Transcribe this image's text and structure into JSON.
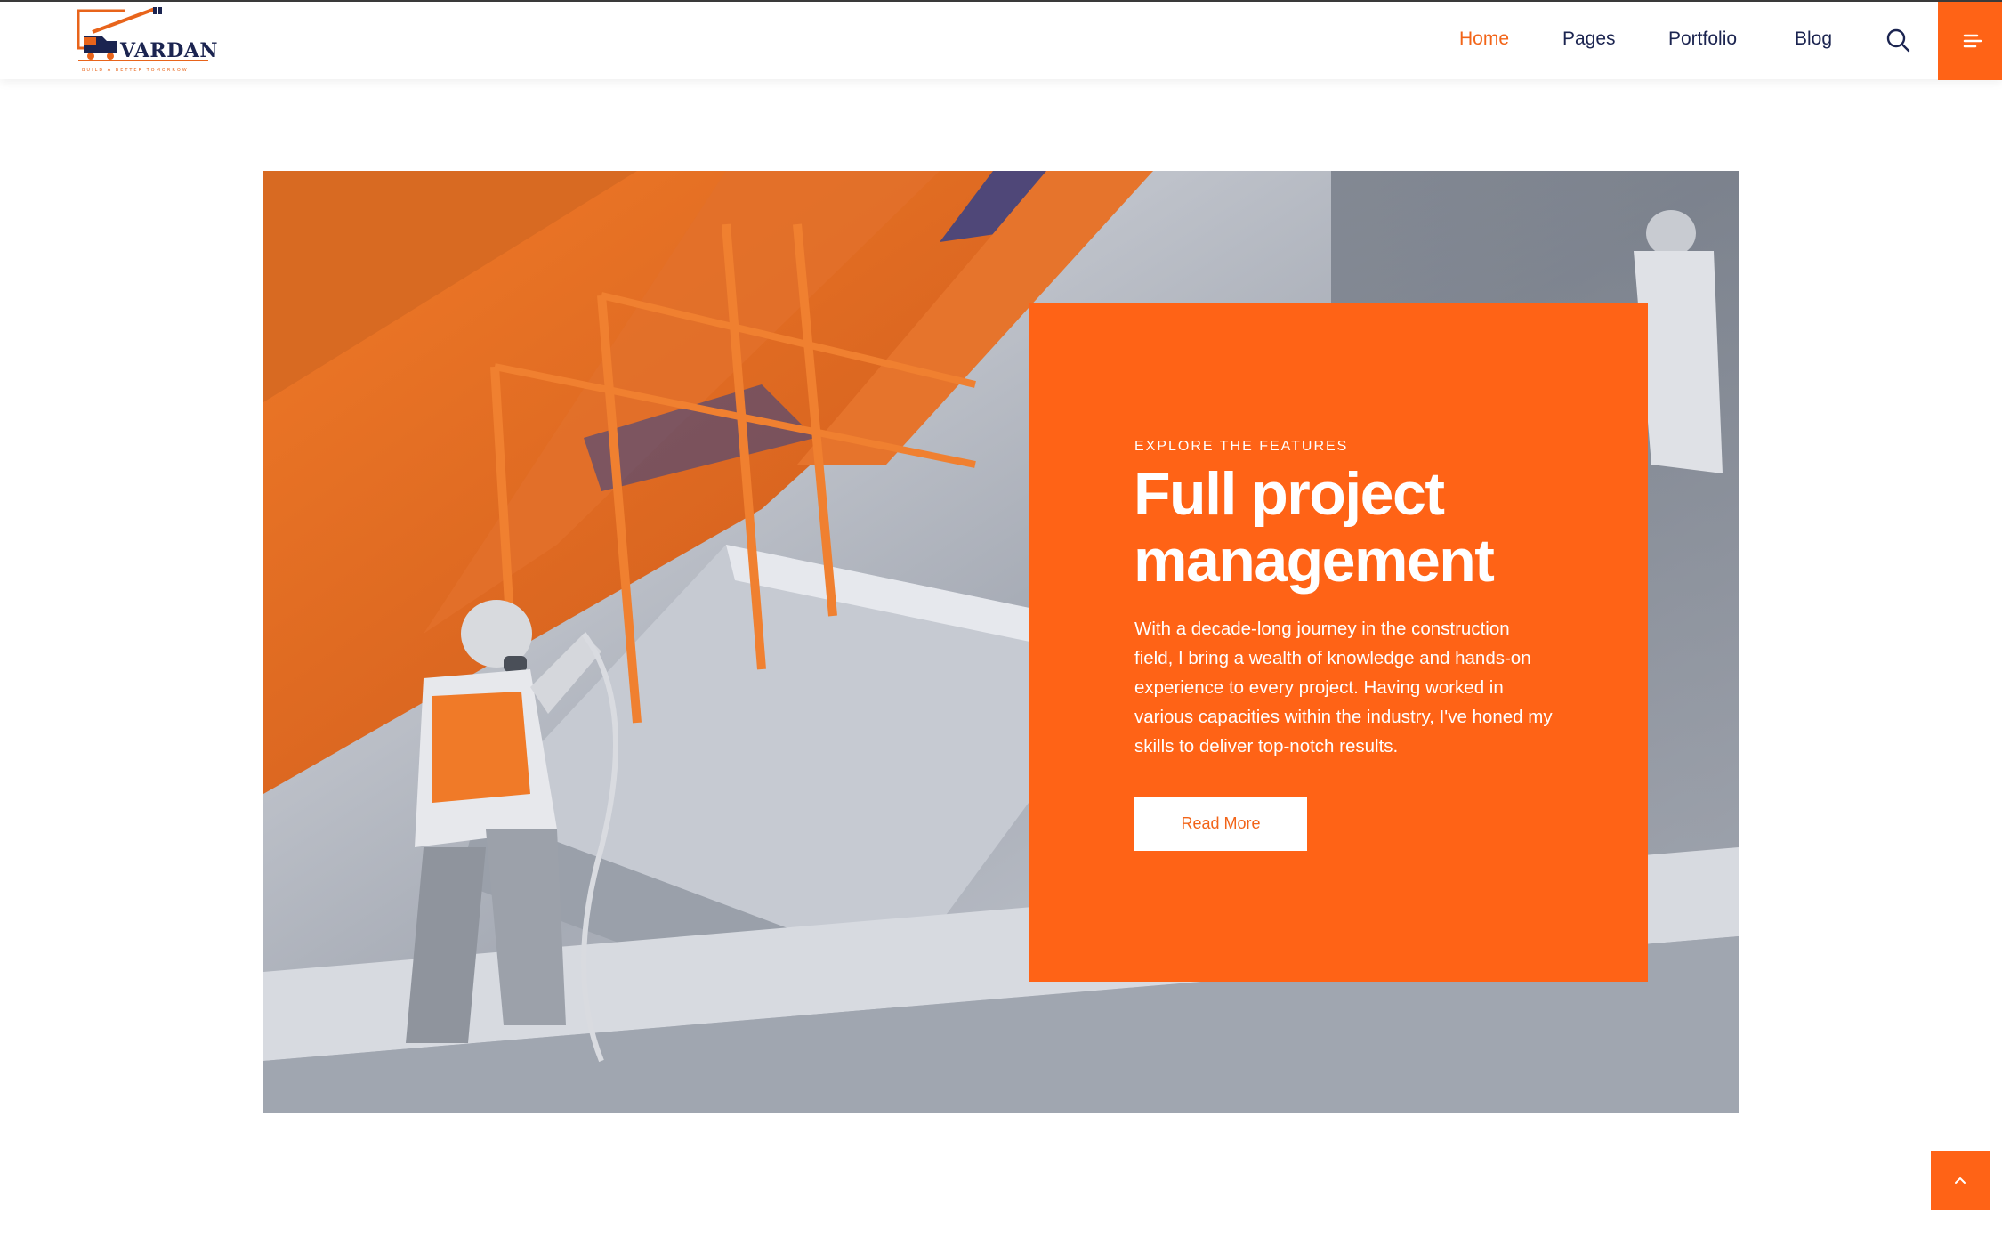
{
  "brand": {
    "name": "VARDAN",
    "tagline": "BUILD A BETTER TOMORROW",
    "accent_color": "#ff6316",
    "navy_color": "#1b2450"
  },
  "nav": {
    "items": [
      {
        "label": "Home",
        "active": true
      },
      {
        "label": "Pages",
        "active": false
      },
      {
        "label": "Portfolio",
        "active": false
      },
      {
        "label": "Blog",
        "active": false
      }
    ],
    "search_icon": "search-icon",
    "menu_icon": "hamburger-menu-icon"
  },
  "hero": {
    "eyebrow": "EXPLORE THE FEATURES",
    "title": "Full project management",
    "text": "With a decade-long journey in the construction field, I bring a wealth of knowledge and hands-on experience to every project. Having worked in various capacities within the industry, I've honed my skills to deliver top-notch results.",
    "button_label": "Read More",
    "image_subject": "construction-worker-spray-painting-steel-structure"
  },
  "scroll_top": {
    "icon": "chevron-up-icon"
  }
}
